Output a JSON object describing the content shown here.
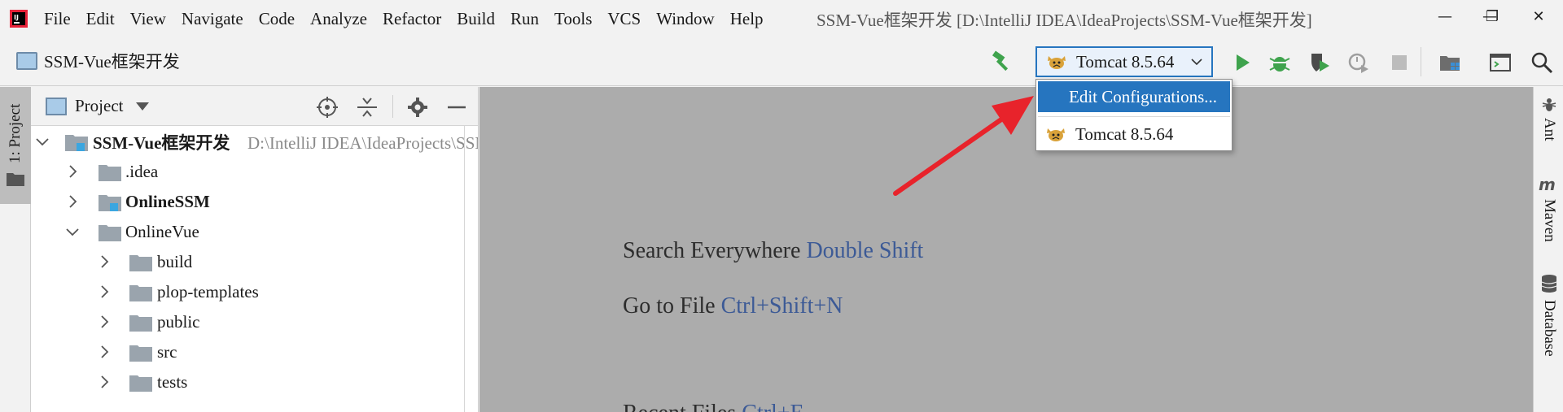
{
  "menu": {
    "items": [
      {
        "label": "File"
      },
      {
        "label": "Edit"
      },
      {
        "label": "View"
      },
      {
        "label": "Navigate"
      },
      {
        "label": "Code"
      },
      {
        "label": "Analyze"
      },
      {
        "label": "Refactor"
      },
      {
        "label": "Build"
      },
      {
        "label": "Run"
      },
      {
        "label": "Tools"
      },
      {
        "label": "VCS"
      },
      {
        "label": "Window"
      },
      {
        "label": "Help"
      }
    ]
  },
  "window": {
    "title": "SSM-Vue框架开发 [D:\\IntelliJ IDEA\\IdeaProjects\\SSM-Vue框架开发]",
    "minimize_glyph": "—",
    "restore_glyph": "❐",
    "close_glyph": "✕"
  },
  "navbar": {
    "breadcrumb": "SSM-Vue框架开发",
    "run_config": "Tomcat 8.5.64"
  },
  "left_strip": {
    "tab_label": "1: Project"
  },
  "project_panel": {
    "title": "Project",
    "tree": [
      {
        "label": "SSM-Vue框架开发",
        "path": "D:\\IntelliJ IDEA\\IdeaProjects\\SSM-Vue框架开发",
        "expanded": true,
        "bold": true,
        "module": true
      },
      {
        "label": ".idea",
        "expanded": false
      },
      {
        "label": "OnlineSSM",
        "expanded": false,
        "bold": true,
        "module": true
      },
      {
        "label": "OnlineVue",
        "expanded": true
      },
      {
        "label": "build",
        "expanded": false
      },
      {
        "label": "plop-templates",
        "expanded": false
      },
      {
        "label": "public",
        "expanded": false
      },
      {
        "label": "src",
        "expanded": false
      },
      {
        "label": "tests",
        "expanded": false
      }
    ]
  },
  "editor": {
    "hints": [
      {
        "text": "Search Everywhere",
        "key": "Double Shift"
      },
      {
        "text": "Go to File",
        "key": "Ctrl+Shift+N"
      },
      {
        "text": "Recent Files",
        "key": "Ctrl+E"
      }
    ]
  },
  "right_strip": {
    "tabs": [
      {
        "label": "Ant"
      },
      {
        "label": "Maven"
      },
      {
        "label": "Database"
      }
    ]
  },
  "popup": {
    "items": [
      {
        "label": "Edit Configurations...",
        "selected": true
      },
      {
        "label": "Tomcat 8.5.64",
        "selected": false
      }
    ]
  },
  "colors": {
    "accent": "#2675bf",
    "annotation_arrow": "#e8232b",
    "run_green": "#3fa34d",
    "editor_bg": "#acacac",
    "shortcut_blue": "#3c5a96"
  }
}
